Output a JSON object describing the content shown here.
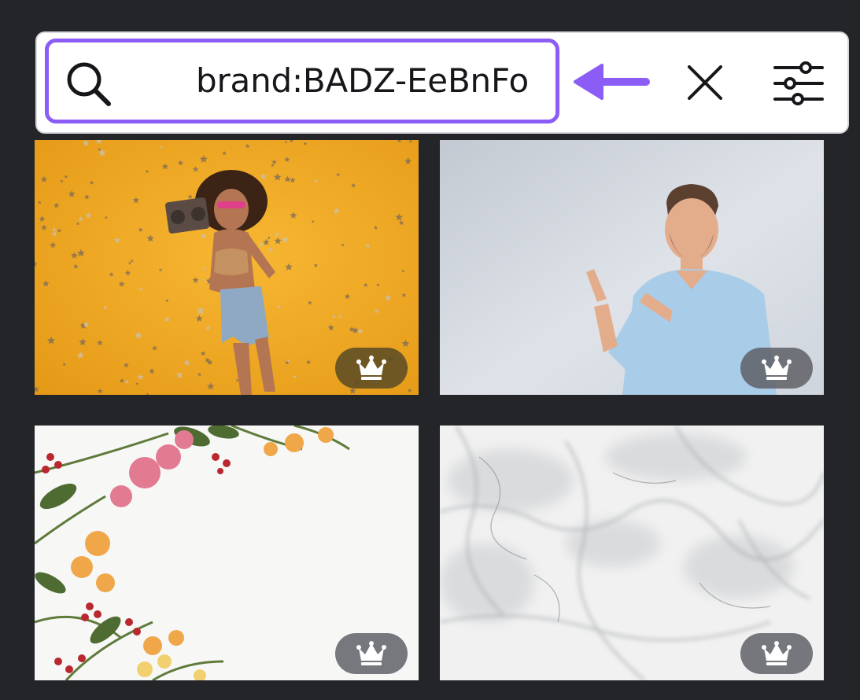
{
  "search": {
    "query": "brand:BADZ-EeBnFo"
  },
  "icons": {
    "search": "search-icon",
    "arrow": "arrow-left-icon",
    "clear": "close-icon",
    "filter": "sliders-icon",
    "premium": "crown-icon"
  },
  "colors": {
    "accent": "#8b5cf6",
    "background": "#242529",
    "badge": "#5a5c62"
  },
  "results": [
    {
      "subject": "woman with boombox and confetti on yellow background",
      "premium": true
    },
    {
      "subject": "man in light blue shirt pointing sideways",
      "premium": true
    },
    {
      "subject": "flowers on white background",
      "premium": true
    },
    {
      "subject": "white marble texture",
      "premium": true
    }
  ]
}
